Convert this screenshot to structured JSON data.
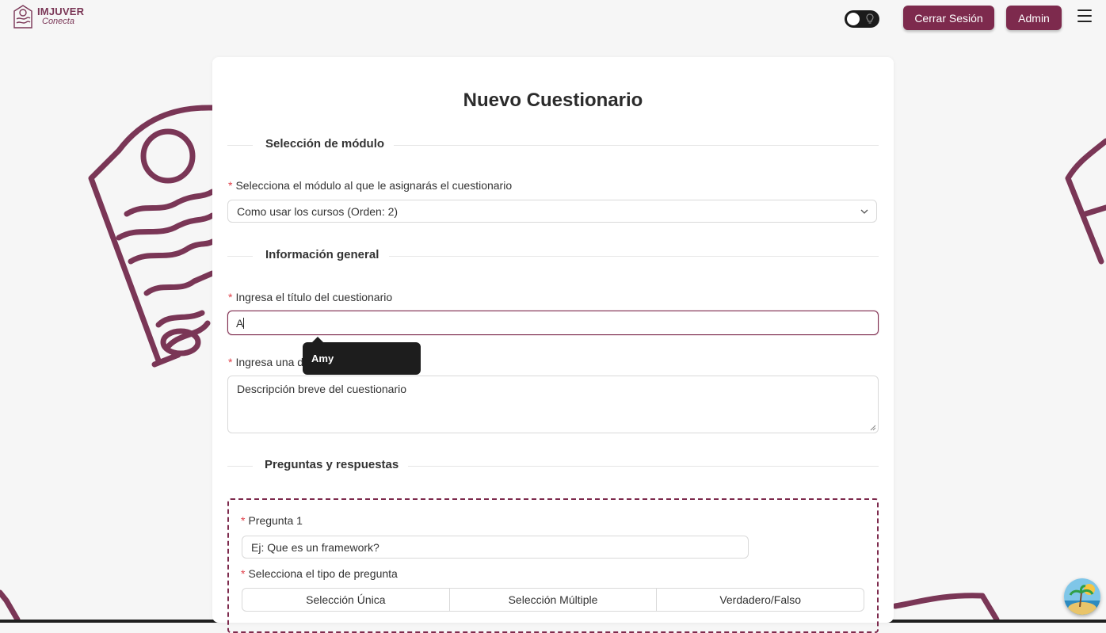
{
  "brand": {
    "title": "IMJUVER",
    "subtitle": "Conecta",
    "color": "#7a3656"
  },
  "header": {
    "logout_label": "Cerrar Sesión",
    "admin_label": "Admin"
  },
  "form": {
    "title": "Nuevo Cuestionario",
    "section_module": "Selección de módulo",
    "module_label": "Selecciona el módulo al que le asignarás el cuestionario",
    "module_value": "Como usar los cursos (Orden: 2)",
    "section_general": "Información general",
    "title_label": "Ingresa el título del cuestionario",
    "title_value": "A",
    "description_label": "Ingresa una de",
    "description_placeholder": "Descripción breve del cuestionario",
    "section_questions": "Preguntas y respuestas",
    "question_label": "Pregunta 1",
    "question_placeholder": "Ej: Que es un framework?",
    "type_label": "Selecciona el tipo de pregunta",
    "type_options": [
      "Selección Única",
      "Selección Múltiple",
      "Verdadero/Falso"
    ]
  },
  "autocomplete": {
    "suggestion": "Amy"
  },
  "colors": {
    "accent": "#7d2a4d",
    "required": "#e0404a"
  }
}
